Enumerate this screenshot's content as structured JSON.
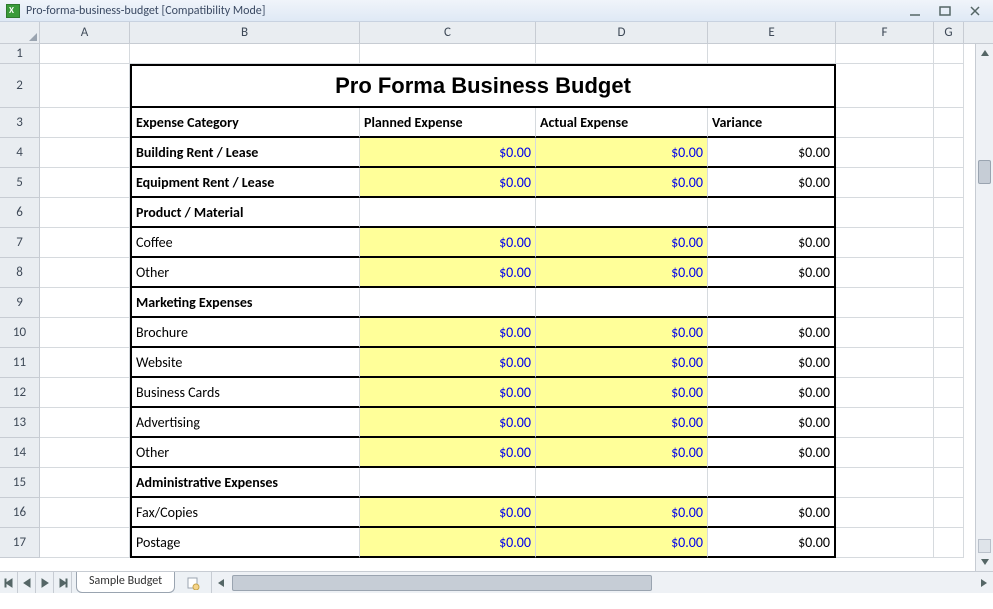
{
  "window": {
    "title": "Pro-forma-business-budget  [Compatibility Mode]"
  },
  "columns": [
    "A",
    "B",
    "C",
    "D",
    "E",
    "F",
    "G"
  ],
  "rowNumbers": [
    1,
    2,
    3,
    4,
    5,
    6,
    7,
    8,
    9,
    10,
    11,
    12,
    13,
    14,
    15,
    16,
    17
  ],
  "sheet": {
    "active_tab": "Sample Budget"
  },
  "budget": {
    "title": "Pro Forma Business Budget",
    "headers": {
      "category": "Expense Category",
      "planned": "Planned Expense",
      "actual": "Actual Expense",
      "variance": "Variance"
    },
    "rows": [
      {
        "label": "Building Rent / Lease",
        "style": "bold",
        "planned": "$0.00",
        "actual": "$0.00",
        "variance": "$0.00",
        "hl": true
      },
      {
        "label": "Equipment Rent / Lease",
        "style": "bold",
        "planned": "$0.00",
        "actual": "$0.00",
        "variance": "$0.00",
        "hl": true
      },
      {
        "label": "Product / Material",
        "style": "bold",
        "planned": "",
        "actual": "",
        "variance": "",
        "hl": false
      },
      {
        "label": "Coffee",
        "style": "",
        "planned": "$0.00",
        "actual": "$0.00",
        "variance": "$0.00",
        "hl": true
      },
      {
        "label": "Other",
        "style": "",
        "planned": "$0.00",
        "actual": "$0.00",
        "variance": "$0.00",
        "hl": true
      },
      {
        "label": "Marketing Expenses",
        "style": "bold",
        "planned": "",
        "actual": "",
        "variance": "",
        "hl": false
      },
      {
        "label": "Brochure",
        "style": "",
        "planned": "$0.00",
        "actual": "$0.00",
        "variance": "$0.00",
        "hl": true
      },
      {
        "label": "Website",
        "style": "",
        "planned": "$0.00",
        "actual": "$0.00",
        "variance": "$0.00",
        "hl": true
      },
      {
        "label": "Business Cards",
        "style": "",
        "planned": "$0.00",
        "actual": "$0.00",
        "variance": "$0.00",
        "hl": true
      },
      {
        "label": "Advertising",
        "style": "",
        "planned": "$0.00",
        "actual": "$0.00",
        "variance": "$0.00",
        "hl": true
      },
      {
        "label": "Other",
        "style": "",
        "planned": "$0.00",
        "actual": "$0.00",
        "variance": "$0.00",
        "hl": true
      },
      {
        "label": "Administrative Expenses",
        "style": "bold",
        "planned": "",
        "actual": "",
        "variance": "",
        "hl": false
      },
      {
        "label": "Fax/Copies",
        "style": "",
        "planned": "$0.00",
        "actual": "$0.00",
        "variance": "$0.00",
        "hl": true
      },
      {
        "label": "Postage",
        "style": "",
        "planned": "$0.00",
        "actual": "$0.00",
        "variance": "$0.00",
        "hl": true
      }
    ]
  },
  "rowHeights": {
    "r1": 20,
    "r2": 44,
    "rH": 30,
    "rD": 30
  }
}
